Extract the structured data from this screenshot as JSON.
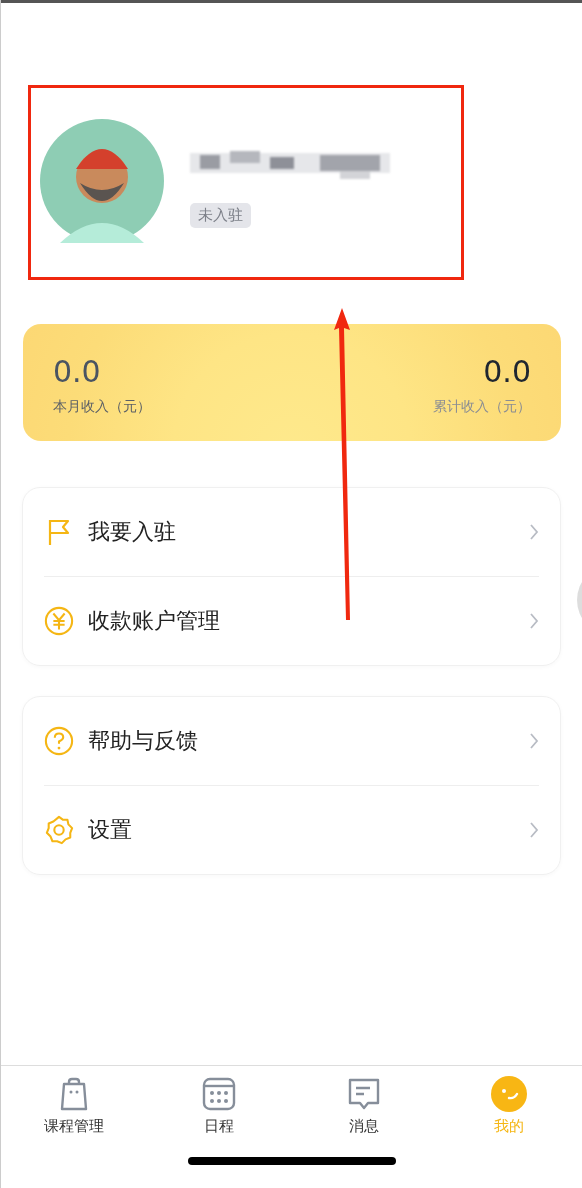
{
  "profile": {
    "badge": "未入驻"
  },
  "income": [
    {
      "value": "0.0",
      "label": "本月收入（元）"
    },
    {
      "value": "0.0",
      "label": "累计收入（元）"
    }
  ],
  "menu_groups": [
    [
      {
        "kind": "flag",
        "label": "我要入驻"
      },
      {
        "kind": "yen",
        "label": "收款账户管理"
      }
    ],
    [
      {
        "kind": "help",
        "label": "帮助与反馈"
      },
      {
        "kind": "gear",
        "label": "设置"
      }
    ]
  ],
  "tabs": [
    {
      "kind": "bag",
      "label": "课程管理",
      "selected": false
    },
    {
      "kind": "calendar",
      "label": "日程",
      "selected": false
    },
    {
      "kind": "message",
      "label": "消息",
      "selected": false
    },
    {
      "kind": "smile",
      "label": "我的",
      "selected": true
    }
  ]
}
